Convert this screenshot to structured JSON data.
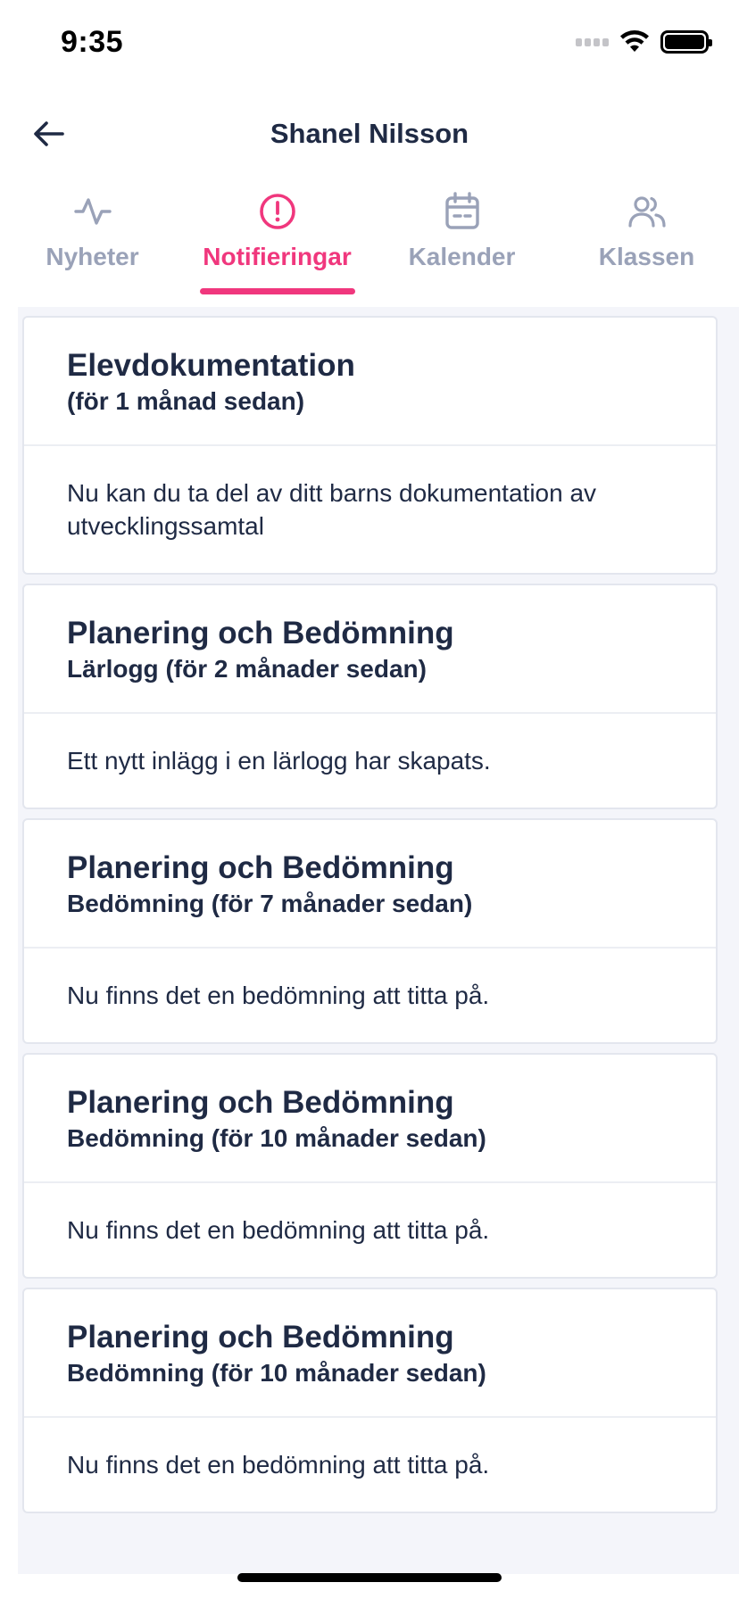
{
  "status_bar": {
    "time": "9:35"
  },
  "header": {
    "title": "Shanel Nilsson"
  },
  "tabs": [
    {
      "label": "Nyheter",
      "icon": "activity-icon",
      "active": false
    },
    {
      "label": "Notifieringar",
      "icon": "alert-circle-icon",
      "active": true
    },
    {
      "label": "Kalender",
      "icon": "calendar-icon",
      "active": false
    },
    {
      "label": "Klassen",
      "icon": "users-icon",
      "active": false
    }
  ],
  "colors": {
    "accent": "#f0377d",
    "inactive_tab": "#9aa2b8",
    "text": "#1f2a44",
    "background": "#f4f5fa"
  },
  "notifications": [
    {
      "title": "Elevdokumentation",
      "subtitle": "(för 1 månad sedan)",
      "body": "Nu kan du ta del av ditt barns dokumentation av utvecklingssamtal"
    },
    {
      "title": "Planering och Bedömning",
      "subtitle": "Lärlogg (för 2 månader sedan)",
      "body": "Ett nytt inlägg i en lärlogg har skapats."
    },
    {
      "title": "Planering och Bedömning",
      "subtitle": "Bedömning (för 7 månader sedan)",
      "body": "Nu finns det en bedömning att titta på."
    },
    {
      "title": "Planering och Bedömning",
      "subtitle": "Bedömning (för 10 månader sedan)",
      "body": "Nu finns det en bedömning att titta på."
    },
    {
      "title": "Planering och Bedömning",
      "subtitle": "Bedömning (för 10 månader sedan)",
      "body": "Nu finns det en bedömning att titta på."
    }
  ]
}
